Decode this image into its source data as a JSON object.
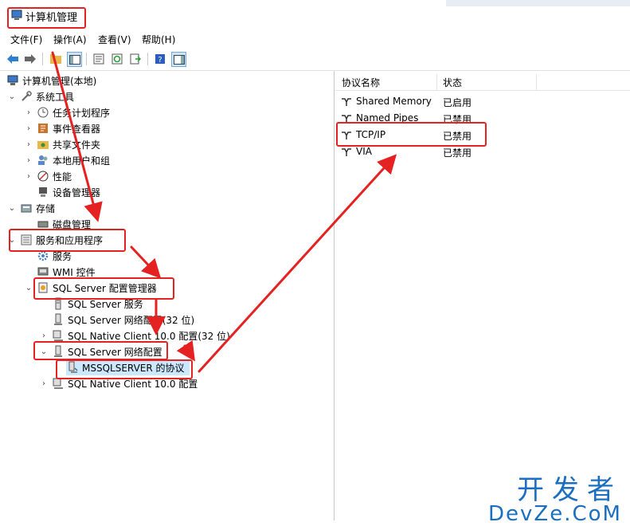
{
  "window": {
    "title": "计算机管理"
  },
  "menu": [
    "文件(F)",
    "操作(A)",
    "查看(V)",
    "帮助(H)"
  ],
  "tree": {
    "root": "计算机管理(本地)",
    "system_tools": "系统工具",
    "task_scheduler": "任务计划程序",
    "event_viewer": "事件查看器",
    "shared_folders": "共享文件夹",
    "local_users": "本地用户和组",
    "performance": "性能",
    "device_manager": "设备管理器",
    "storage": "存储",
    "disk_management": "磁盘管理",
    "services_apps": "服务和应用程序",
    "services": "服务",
    "wmi": "WMI 控件",
    "sql_config": "SQL Server 配置管理器",
    "sql_services": "SQL Server 服务",
    "sql_net32": "SQL Server 网络配置(32 位)",
    "native_client32": "SQL Native Client 10.0 配置(32 位)",
    "sql_net": "SQL Server 网络配置",
    "mssql_protocols": "MSSQLSERVER 的协议",
    "native_client": "SQL Native Client 10.0 配置"
  },
  "list": {
    "columns": [
      "协议名称",
      "状态"
    ],
    "rows": [
      {
        "name": "Shared Memory",
        "status": "已启用"
      },
      {
        "name": "Named Pipes",
        "status": "已禁用"
      },
      {
        "name": "TCP/IP",
        "status": "已禁用"
      },
      {
        "name": "VIA",
        "status": "已禁用"
      }
    ]
  },
  "watermark": {
    "cn": "开发者",
    "en": "DevZe.CoM"
  },
  "colors": {
    "annotation": "#e52222",
    "selection": "#cce8ff",
    "watermark": "#1a6fc0"
  }
}
